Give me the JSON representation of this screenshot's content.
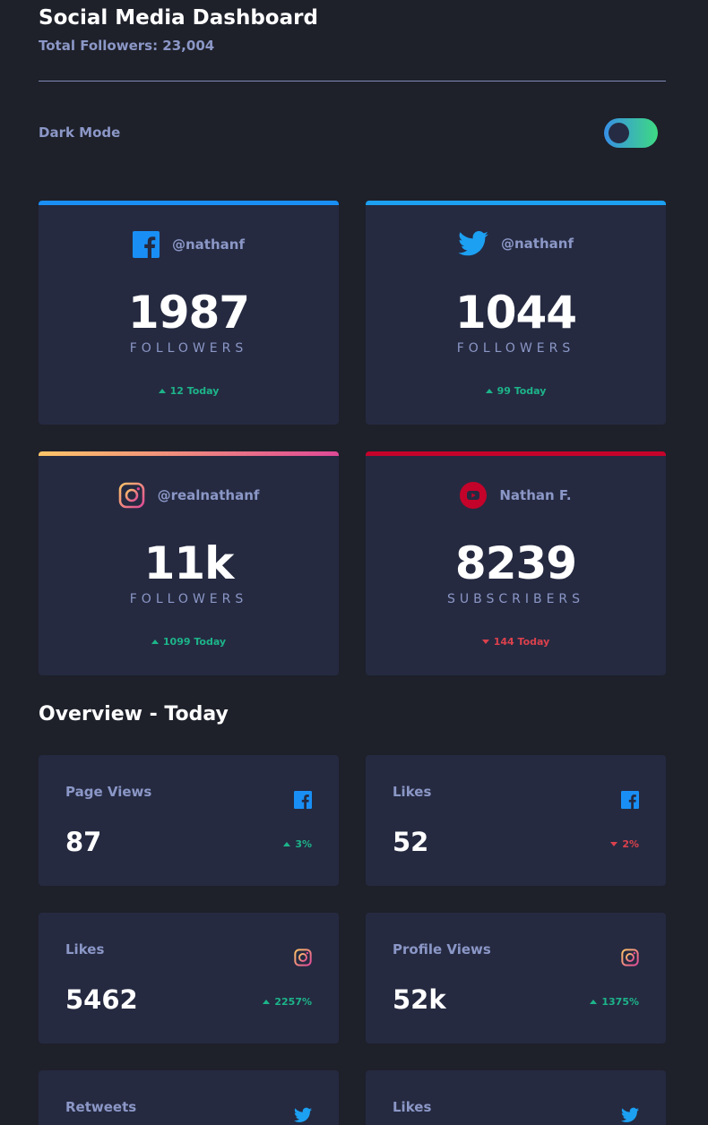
{
  "header": {
    "title": "Social Media Dashboard",
    "total_followers": "Total Followers: 23,004",
    "dark_mode_label": "Dark Mode"
  },
  "colors": {
    "background": "#1e202a",
    "card": "#252a41",
    "muted_text": "#8b97c6",
    "up": "#1db489",
    "down": "#dc414c",
    "facebook": "#198ff5",
    "twitter": "#1ca0f2",
    "youtube": "#c4032a"
  },
  "cards": [
    {
      "platform": "facebook",
      "icon": "facebook-icon",
      "handle": "@nathanf",
      "count": "1987",
      "unit": "FOLLOWERS",
      "today": "12 Today",
      "trend": "up"
    },
    {
      "platform": "twitter",
      "icon": "twitter-icon",
      "handle": "@nathanf",
      "count": "1044",
      "unit": "FOLLOWERS",
      "today": "99 Today",
      "trend": "up"
    },
    {
      "platform": "instagram",
      "icon": "instagram-icon",
      "handle": "@realnathanf",
      "count": "11k",
      "unit": "FOLLOWERS",
      "today": "1099 Today",
      "trend": "up"
    },
    {
      "platform": "youtube",
      "icon": "youtube-icon",
      "handle": "Nathan F.",
      "count": "8239",
      "unit": "SUBSCRIBERS",
      "today": "144 Today",
      "trend": "down"
    }
  ],
  "overview": {
    "title": "Overview - Today",
    "items": [
      {
        "label": "Page Views",
        "icon": "facebook-icon",
        "value": "87",
        "pct": "3%",
        "trend": "up"
      },
      {
        "label": "Likes",
        "icon": "facebook-icon",
        "value": "52",
        "pct": "2%",
        "trend": "down"
      },
      {
        "label": "Likes",
        "icon": "instagram-icon",
        "value": "5462",
        "pct": "2257%",
        "trend": "up"
      },
      {
        "label": "Profile Views",
        "icon": "instagram-icon",
        "value": "52k",
        "pct": "1375%",
        "trend": "up"
      },
      {
        "label": "Retweets",
        "icon": "twitter-icon",
        "value": "",
        "pct": "",
        "trend": "up"
      },
      {
        "label": "Likes",
        "icon": "twitter-icon",
        "value": "",
        "pct": "",
        "trend": "up"
      }
    ]
  }
}
